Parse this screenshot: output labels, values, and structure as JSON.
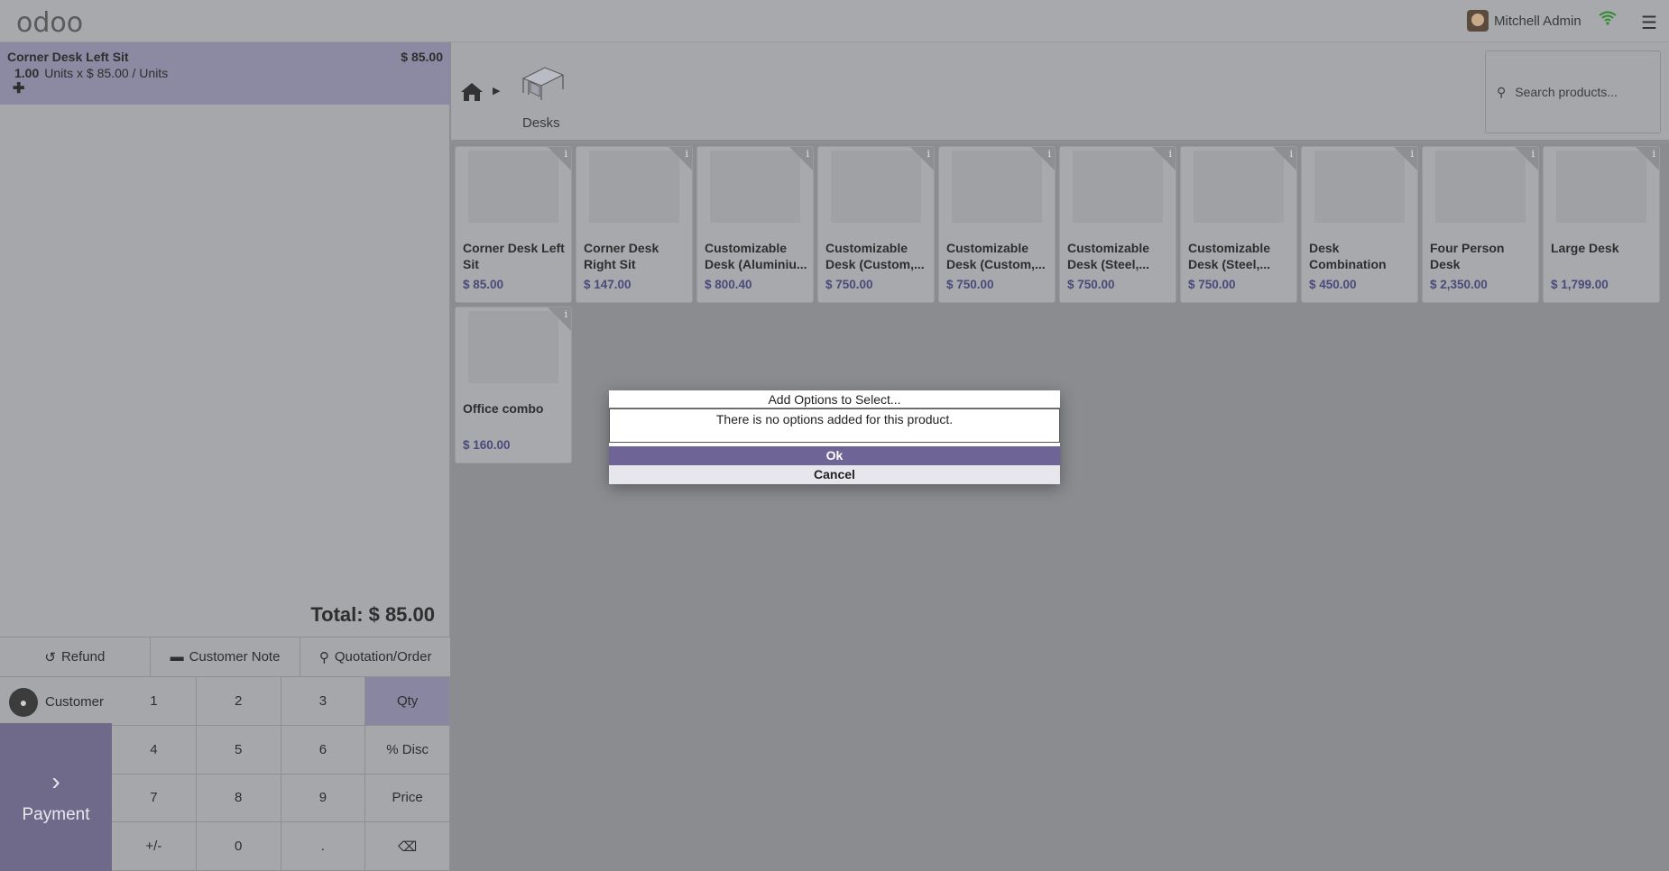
{
  "topbar": {
    "logo": "odoo",
    "user_name": "Mitchell Admin",
    "icons": [
      "avatar",
      "wifi-icon",
      "hamburger-menu-icon"
    ]
  },
  "order": {
    "line": {
      "name": "Corner Desk Left Sit",
      "price": "$ 85.00",
      "qty": "1.00",
      "unit_detail": "Units x $ 85.00 / Units"
    },
    "total_label": "Total:",
    "total_value": "$ 85.00"
  },
  "controls": {
    "refund": "Refund",
    "customer_note": "Customer Note",
    "quotation": "Quotation/Order"
  },
  "customer_label": "Customer",
  "payment_label": "Payment",
  "numpad": [
    "1",
    "2",
    "3",
    "Qty",
    "4",
    "5",
    "6",
    "% Disc",
    "7",
    "8",
    "9",
    "Price",
    "+/-",
    "0",
    ".",
    "⌫"
  ],
  "numpad_active": "Qty",
  "breadcrumb": {
    "category": "Desks"
  },
  "search": {
    "placeholder": "Search products..."
  },
  "products": [
    {
      "name": "Corner Desk Left Sit",
      "price": "$ 85.00"
    },
    {
      "name": "Corner Desk Right Sit",
      "price": "$ 147.00"
    },
    {
      "name": "Customizable Desk (Aluminiu...",
      "price": "$ 800.40"
    },
    {
      "name": "Customizable Desk (Custom,...",
      "price": "$ 750.00"
    },
    {
      "name": "Customizable Desk (Custom,...",
      "price": "$ 750.00"
    },
    {
      "name": "Customizable Desk (Steel,...",
      "price": "$ 750.00"
    },
    {
      "name": "Customizable Desk (Steel,...",
      "price": "$ 750.00"
    },
    {
      "name": "Desk Combination",
      "price": "$ 450.00"
    },
    {
      "name": "Four Person Desk",
      "price": "$ 2,350.00"
    },
    {
      "name": "Large Desk",
      "price": "$ 1,799.00"
    },
    {
      "name": "Office combo",
      "price": "$ 160.00"
    }
  ],
  "dialog": {
    "title": "Add Options to Select...",
    "message": "There is no options added for this product.",
    "ok": "Ok",
    "cancel": "Cancel"
  }
}
